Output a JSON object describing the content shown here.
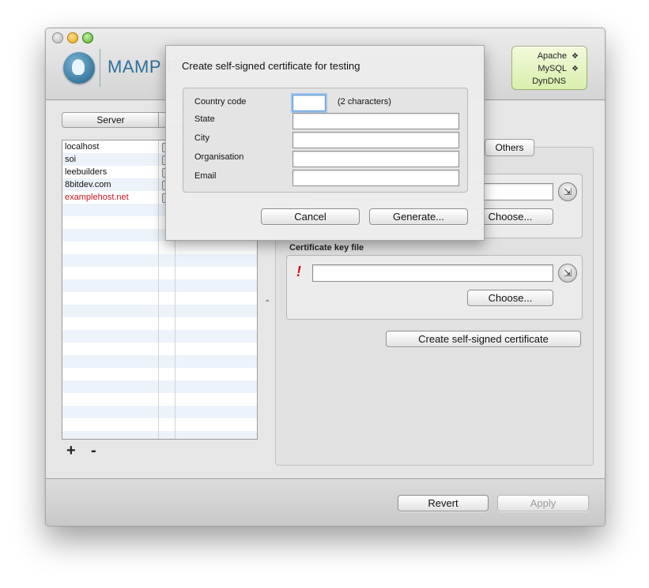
{
  "app": {
    "brand": "MAMP P",
    "status": {
      "items": [
        {
          "label": "Apache",
          "indicator": "❖"
        },
        {
          "label": "MySQL",
          "indicator": "❖"
        },
        {
          "label": "DynDNS",
          "indicator": ""
        }
      ]
    }
  },
  "toolbar": {
    "server_tab": "Server"
  },
  "hosts": {
    "items": [
      {
        "name": "localhost"
      },
      {
        "name": "soi"
      },
      {
        "name": "leebuilders"
      },
      {
        "name": "8bitdev.com"
      },
      {
        "name": "examplehost.net"
      }
    ],
    "add_label": "+",
    "remove_label": "-"
  },
  "ssl_panel": {
    "tab_others": "Others",
    "cert_key_label": "Certificate key file",
    "warning_mark": "!",
    "choose_label": "Choose...",
    "create_cert_label": "Create self-signed certificate"
  },
  "footer": {
    "revert_label": "Revert",
    "apply_label": "Apply"
  },
  "dialog": {
    "title": "Create self-signed certificate for testing",
    "fields": {
      "country": {
        "label": "Country code",
        "value": "",
        "hint": "(2 characters)"
      },
      "state": {
        "label": "State",
        "value": ""
      },
      "city": {
        "label": "City",
        "value": ""
      },
      "organisation": {
        "label": "Organisation",
        "value": ""
      },
      "email": {
        "label": "Email",
        "value": ""
      }
    },
    "cancel_label": "Cancel",
    "generate_label": "Generate..."
  },
  "colors": {
    "accent_blue": "#2f6f98",
    "selected_host_red": "#c4161c",
    "status_green_bg": "#d9efae"
  }
}
